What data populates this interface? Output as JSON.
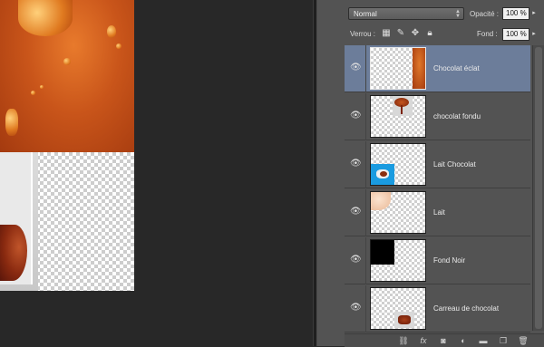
{
  "blend": {
    "mode": "Normal",
    "opacity_label": "Opacité :",
    "opacity_value": "100 %"
  },
  "lock": {
    "label": "Verrou :",
    "fill_label": "Fond :",
    "fill_value": "100 %"
  },
  "layers": [
    {
      "name": "Chocolat éclat",
      "selected": true,
      "visible": true
    },
    {
      "name": "chocolat fondu",
      "selected": false,
      "visible": true
    },
    {
      "name": "Lait Chocolat",
      "selected": false,
      "visible": true
    },
    {
      "name": "Lait",
      "selected": false,
      "visible": true
    },
    {
      "name": "Fond Noir",
      "selected": false,
      "visible": true
    },
    {
      "name": "Carreau de chocolat",
      "selected": false,
      "visible": true
    }
  ],
  "icons": {
    "eye": "eye-icon",
    "lock_pixels": "lock-transparent-icon",
    "lock_paint": "brush-lock-icon",
    "lock_move": "move-lock-icon",
    "lock_all": "padlock-icon",
    "bottom": [
      "link-icon",
      "fx-icon",
      "mask-icon",
      "adjustment-icon",
      "folder-icon",
      "new-layer-icon",
      "trash-icon"
    ]
  },
  "colors": {
    "panel": "#535353",
    "selected_layer": "#6c7d9a",
    "canvas_bg": "#282828"
  }
}
